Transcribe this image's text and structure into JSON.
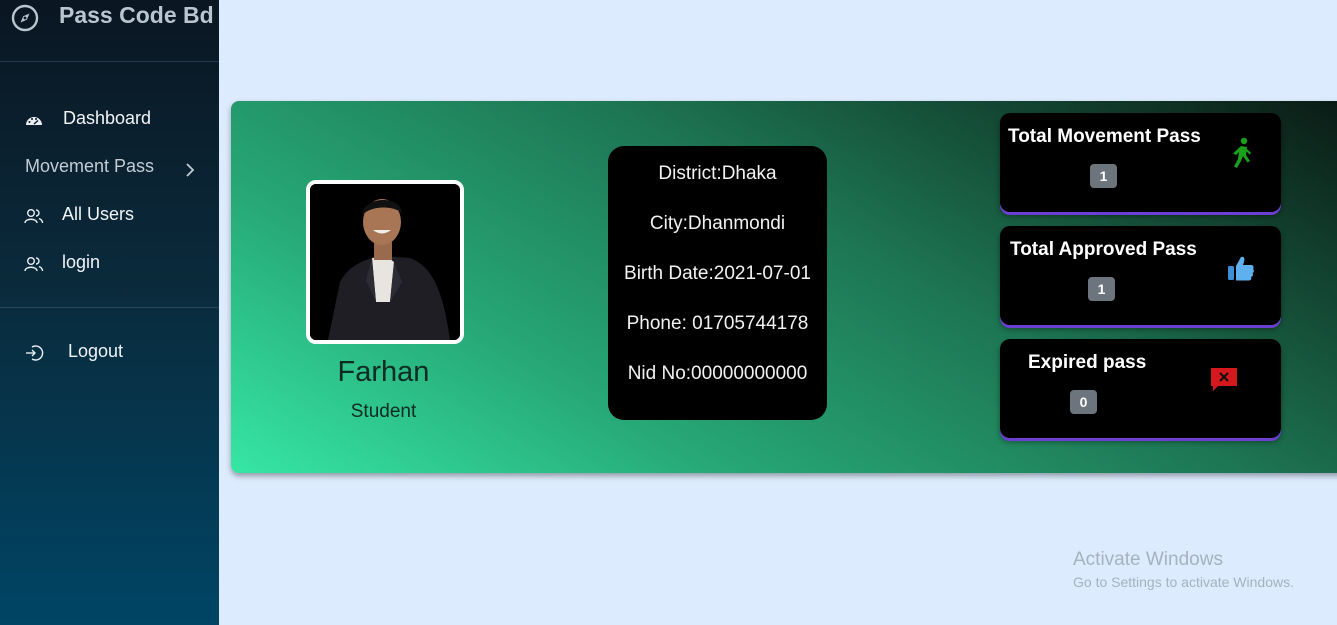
{
  "brand": {
    "title": "Pass Code Bd",
    "icon": "compass-icon"
  },
  "sidebar": {
    "items": [
      {
        "label": "Dashboard",
        "icon": "dashboard-gauge-icon"
      },
      {
        "label": "Movement Pass",
        "icon": "chevron-right-icon"
      },
      {
        "label": "All Users",
        "icon": "users-icon"
      },
      {
        "label": "login",
        "icon": "users-icon"
      }
    ],
    "logout": {
      "label": "Logout",
      "icon": "logout-icon"
    }
  },
  "profile": {
    "name": "Farhan",
    "role": "Student",
    "district": "District:Dhaka",
    "city": "City:Dhanmondi",
    "birth_date": "Birth Date:2021-07-01",
    "phone": "Phone: 01705744178",
    "nid": "Nid No:00000000000"
  },
  "stats": {
    "total_movement": {
      "title": "Total Movement Pass",
      "count": "1",
      "icon": "walking-person-icon",
      "icon_color": "#1aa11a"
    },
    "total_approved": {
      "title": "Total Approved Pass",
      "count": "1",
      "icon": "thumbs-up-icon",
      "icon_color": "#3d8fd6"
    },
    "expired": {
      "title": "Expired pass",
      "count": "0",
      "icon": "red-x-comment-icon",
      "icon_color": "#d4181d"
    }
  },
  "watermark": {
    "line1": "Activate Windows",
    "line2": "Go to Settings to activate Windows."
  },
  "colors": {
    "sidebar_top": "#0a1622",
    "sidebar_bottom": "#004565",
    "page_bg": "#dcebfd",
    "card_green": "#36e6a5",
    "badge_gray": "#6c757d",
    "stat_border": "#6b3fcf"
  }
}
